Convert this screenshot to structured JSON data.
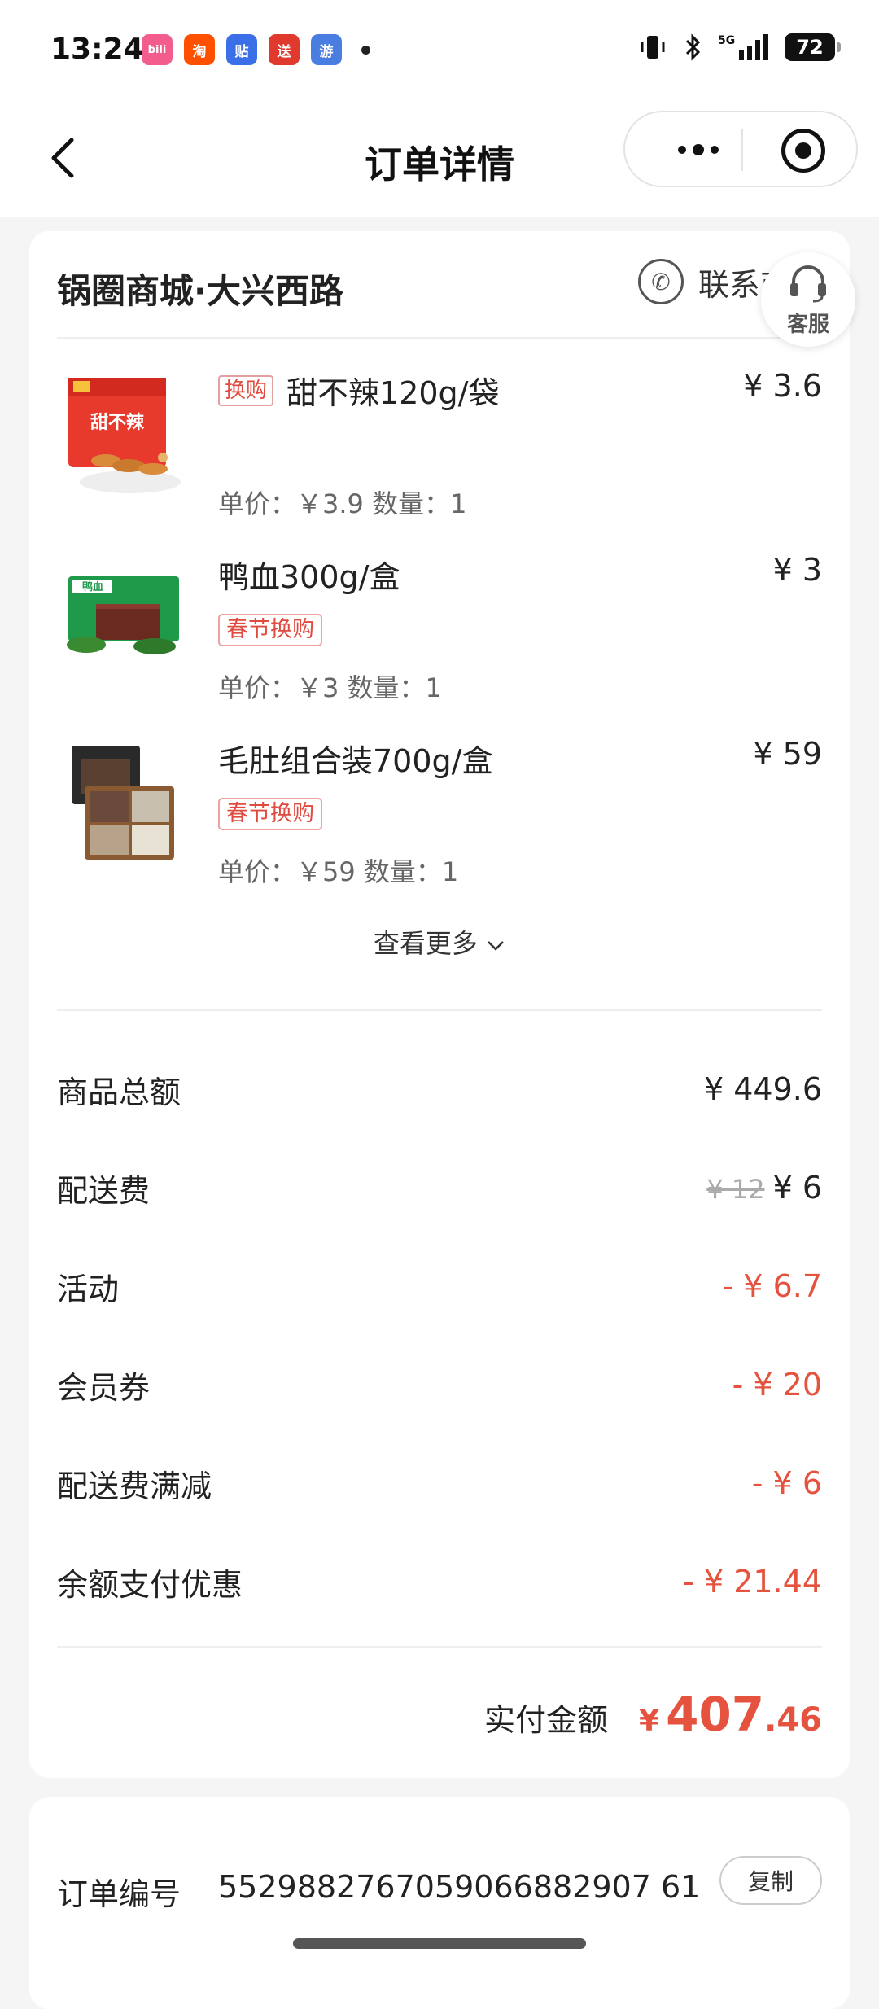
{
  "status_bar": {
    "time": "13:24",
    "apps": [
      {
        "name": "bilibili",
        "glyph": "bili",
        "color": "#f25d8e"
      },
      {
        "name": "taobao",
        "glyph": "淘",
        "color": "#ff5000"
      },
      {
        "name": "tieba",
        "glyph": "贴",
        "color": "#3a6fe8"
      },
      {
        "name": "meituan",
        "glyph": "送",
        "color": "#e03a2e"
      },
      {
        "name": "game",
        "glyph": "游",
        "color": "#4a7de0"
      }
    ],
    "network": "5G",
    "battery": "72"
  },
  "nav": {
    "title": "订单详情"
  },
  "store": {
    "name": "锅圈商城·大兴西路",
    "contact_label": "联系商家"
  },
  "kefu_label": "客服",
  "items": [
    {
      "name": "甜不辣120g/袋",
      "inline_tag": "换购",
      "tag": "",
      "price": "¥ 3.6",
      "meta": "单价：￥3.9  数量：1",
      "thumb_label": "甜不辣"
    },
    {
      "name": "鸭血300g/盒",
      "inline_tag": "",
      "tag": "春节换购",
      "price": "¥ 3",
      "meta": "单价：￥3  数量：1",
      "thumb_label": "鸭血"
    },
    {
      "name": "毛肚组合装700g/盒",
      "inline_tag": "",
      "tag": "春节换购",
      "price": "¥ 59",
      "meta": "单价：￥59  数量：1",
      "thumb_label": ""
    }
  ],
  "see_more": "查看更多",
  "summary": {
    "goods_total_label": "商品总额",
    "goods_total": "¥ 449.6",
    "delivery_label": "配送费",
    "delivery_original": "¥ 12",
    "delivery": "¥ 6",
    "activity_label": "活动",
    "activity": "- ¥ 6.7",
    "coupon_label": "会员券",
    "coupon": "- ¥ 20",
    "delivery_discount_label": "配送费满减",
    "delivery_discount": "- ¥ 6",
    "balance_label": "余额支付优惠",
    "balance": "- ¥ 21.44"
  },
  "total": {
    "label": "实付金额",
    "currency": "¥",
    "integer": "407",
    "decimal": ".46"
  },
  "order": {
    "label": "订单编号",
    "number": "5529882767059066882907 61",
    "copy_label": "复制"
  },
  "colors": {
    "accent_red": "#e5533f",
    "tag_red": "#e04a3f"
  }
}
